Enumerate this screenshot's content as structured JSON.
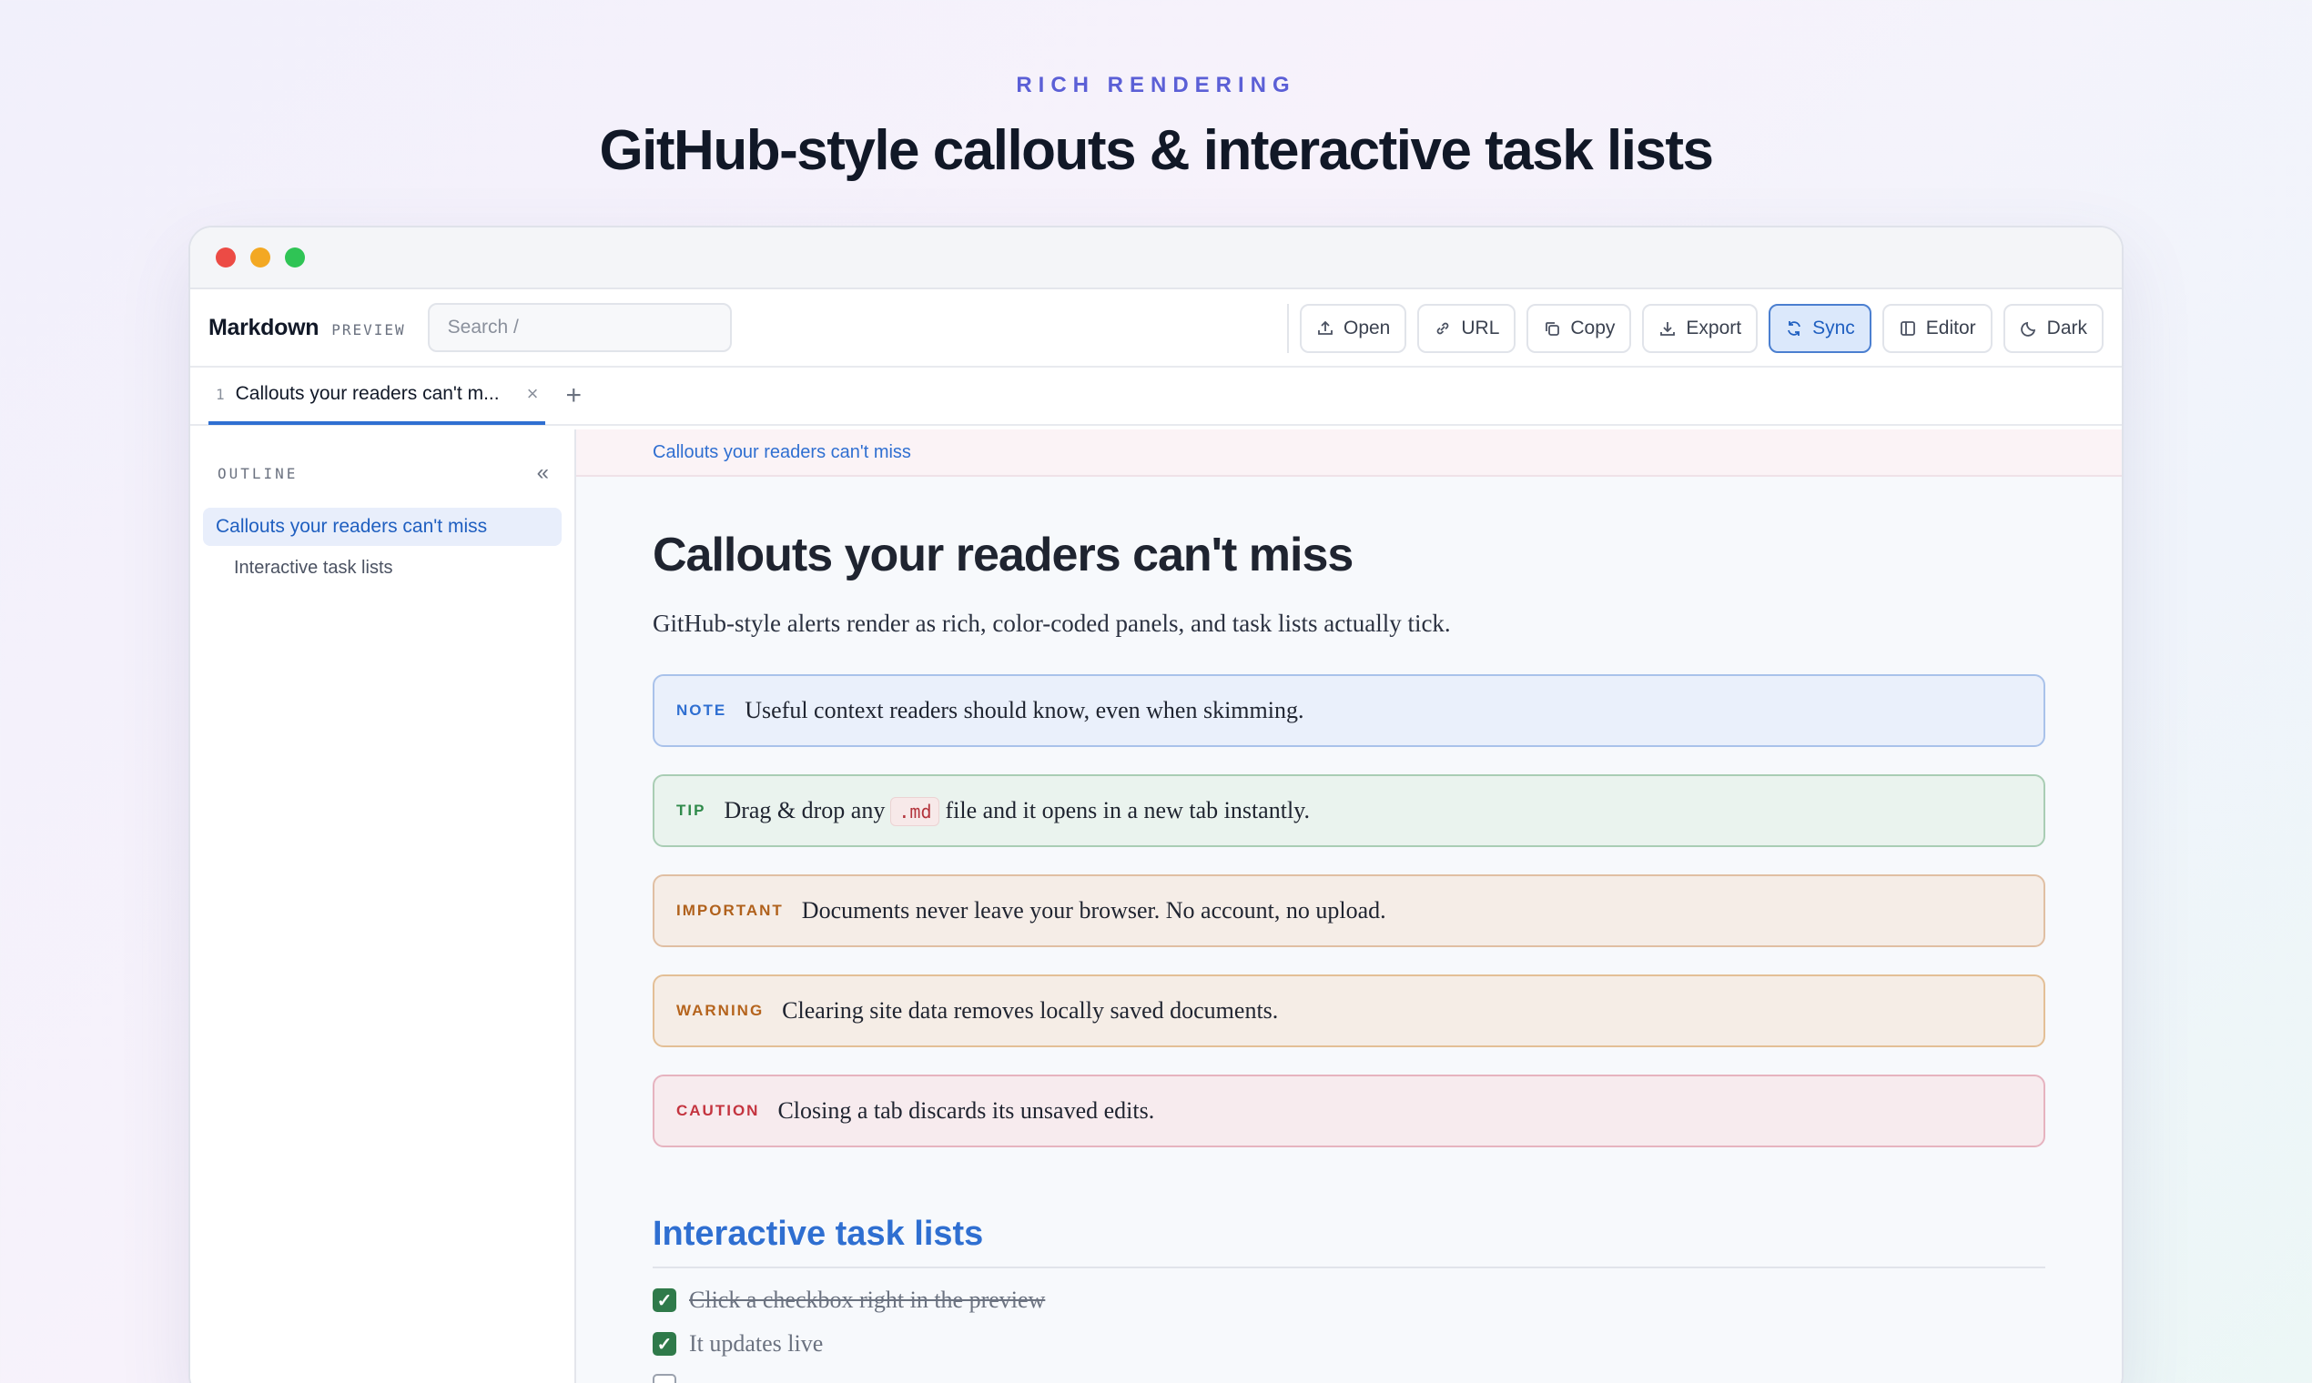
{
  "hero": {
    "kicker": "RICH RENDERING",
    "title": "GitHub-style callouts & interactive task lists"
  },
  "toolbar": {
    "brand": "Markdown",
    "brand_sub": "PREVIEW",
    "search_placeholder": "Search  /",
    "buttons": {
      "open": "Open",
      "url": "URL",
      "copy": "Copy",
      "export": "Export",
      "sync": "Sync",
      "editor": "Editor",
      "dark": "Dark"
    }
  },
  "tabs": [
    {
      "num": "1",
      "label": "Callouts your readers can't m..."
    }
  ],
  "sidebar": {
    "title": "OUTLINE",
    "items": [
      {
        "label": "Callouts your readers can't miss",
        "active": true
      },
      {
        "label": "Interactive task lists",
        "active": false
      }
    ]
  },
  "breadcrumb": "Callouts your readers can't miss",
  "doc": {
    "title": "Callouts your readers can't miss",
    "lead": "GitHub-style alerts render as rich, color-coded panels, and task lists actually tick.",
    "callouts": {
      "note": {
        "tag": "NOTE",
        "text": "Useful context readers should know, even when skimming."
      },
      "tip": {
        "tag": "TIP",
        "text_before": "Drag & drop any",
        "code": ".md",
        "text_after": "file and it opens in a new tab instantly."
      },
      "important": {
        "tag": "IMPORTANT",
        "text": "Documents never leave your browser. No account, no upload."
      },
      "warning": {
        "tag": "WARNING",
        "text": "Clearing site data removes locally saved documents."
      },
      "caution": {
        "tag": "CAUTION",
        "text": "Closing a tab discards its unsaved edits."
      }
    },
    "section_heading": "Interactive task lists",
    "tasks": [
      {
        "text": "Click a checkbox right in the preview",
        "checked": true
      },
      {
        "text": "It updates live",
        "checked": true
      }
    ]
  },
  "colors": {
    "accent": "#2f6fd1",
    "kicker": "#5b5fd6",
    "note": "#2f6fd1",
    "tip": "#2f8a4a",
    "important": "#b0611c",
    "warning": "#b5641d",
    "caution": "#c4343f",
    "check": "#2f7a4a"
  }
}
